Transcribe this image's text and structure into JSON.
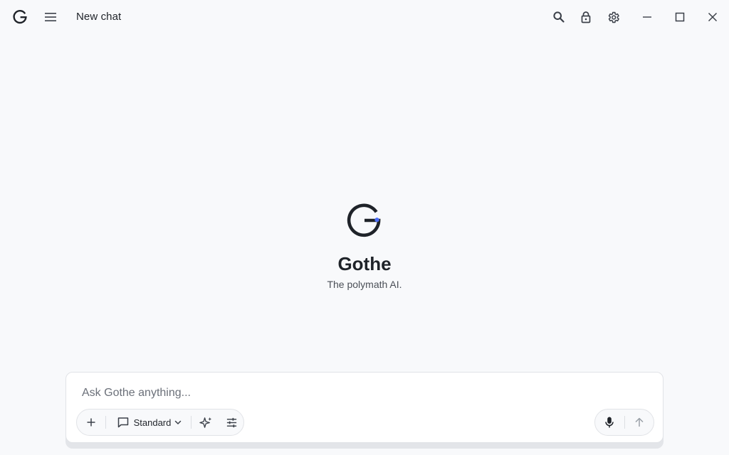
{
  "window": {
    "title": "New chat"
  },
  "titlebar": {
    "logo": "gothe-logo",
    "menu_icon": "hamburger-icon",
    "actions": [
      "search-icon",
      "lock-icon",
      "gear-icon"
    ],
    "window_controls": [
      "minimize-icon",
      "maximize-icon",
      "close-icon"
    ]
  },
  "brand": {
    "name": "Gothe",
    "tagline": "The polymath AI.",
    "accent_color": "#4a6cf7",
    "ink_color": "#1f2329"
  },
  "composer": {
    "placeholder": "Ask Gothe anything...",
    "value": "",
    "mode_label": "Standard",
    "tools": [
      "plus-icon",
      "chat-bubble-icon",
      "chevron-down-icon",
      "sparkle-icon",
      "sliders-icon"
    ],
    "voice": [
      "microphone-icon",
      "arrow-up-icon"
    ]
  }
}
